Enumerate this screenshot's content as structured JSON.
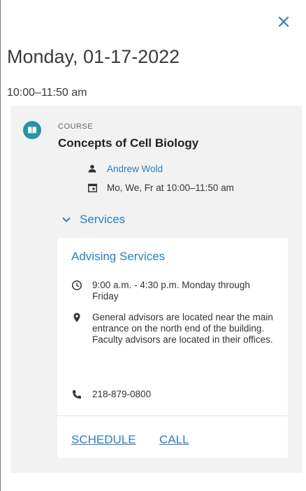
{
  "header": {
    "close_icon": "close-icon"
  },
  "event": {
    "date": "Monday, 01-17-2022",
    "time_range": "10:00–11:50 am",
    "course_label": "COURSE",
    "course_name": "Concepts of Cell Biology",
    "instructor": "Andrew Wold",
    "meeting_schedule": "Mo, We, Fr at 10:00–11:50 am"
  },
  "services": {
    "toggle_label": "Services",
    "items": [
      {
        "title": "Advising Services",
        "hours": "9:00 a.m. - 4:30 p.m. Monday through Friday",
        "location": "General advisors are located near the main entrance on the north end of the building. Faculty advisors are located in their offices.",
        "phone": "218-879-0800",
        "actions": {
          "schedule": "SCHEDULE",
          "call": "CALL"
        }
      }
    ]
  },
  "colors": {
    "accent": "#2a7fbf",
    "course_icon": "#2593a8",
    "panel_bg": "#f2f2f2",
    "card_bg": "#ffffff"
  }
}
